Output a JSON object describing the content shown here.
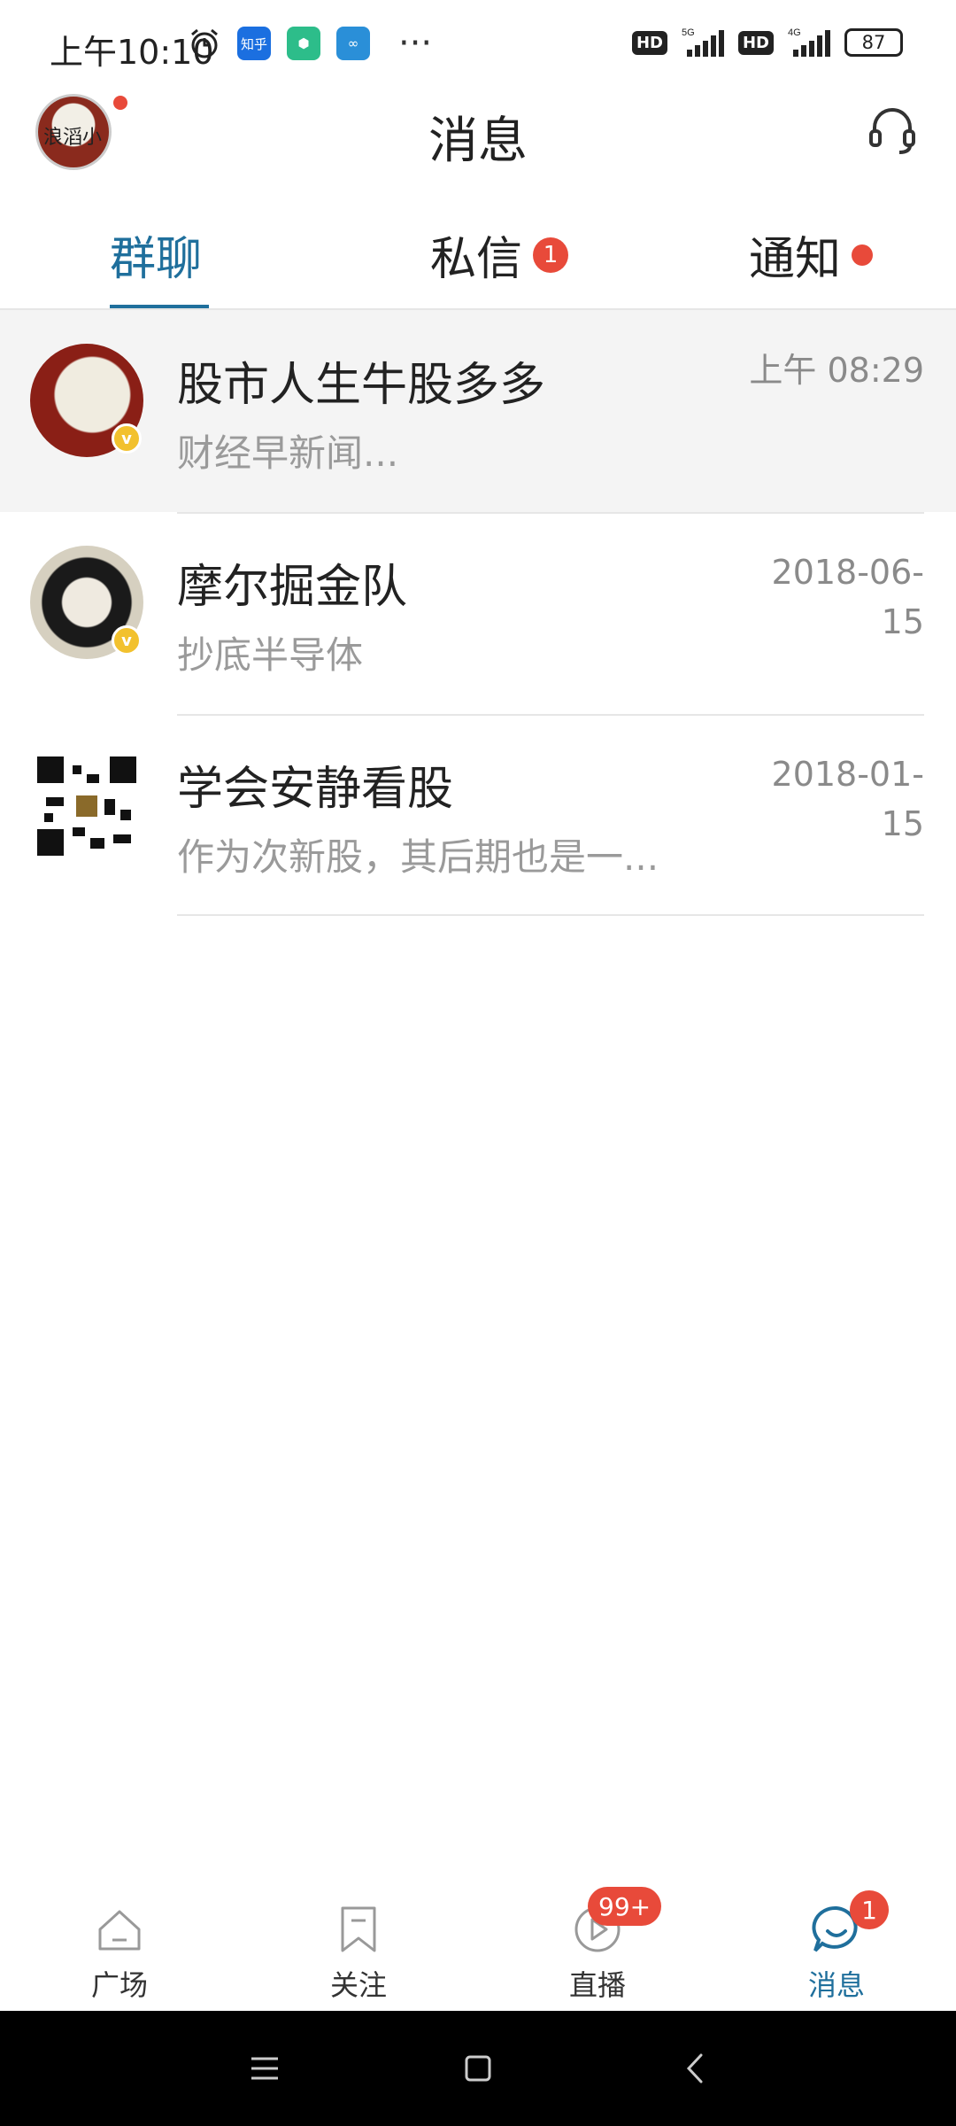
{
  "status_bar": {
    "time": "上午10:10",
    "apps": [
      "知乎"
    ],
    "battery": "87"
  },
  "header": {
    "title": "消息"
  },
  "tabs": [
    {
      "label": "群聊",
      "active": true
    },
    {
      "label": "私信",
      "badge": "1"
    },
    {
      "label": "通知",
      "dot": true
    }
  ],
  "conversations": [
    {
      "name": "股市人生牛股多多",
      "preview": "财经早新闻...",
      "time": "上午 08:29",
      "verified": true,
      "highlighted": true
    },
    {
      "name": "摩尔掘金队",
      "preview": "抄底半导体",
      "time": "2018-06-15",
      "verified": true
    },
    {
      "name": "学会安静看股",
      "preview": "作为次新股，其后期也是一...",
      "time": "2018-01-15"
    }
  ],
  "bottom_nav": [
    {
      "label": "广场",
      "icon": "home-icon"
    },
    {
      "label": "关注",
      "icon": "bookmark-icon"
    },
    {
      "label": "直播",
      "icon": "play-icon",
      "badge": "99+"
    },
    {
      "label": "消息",
      "icon": "chat-bubble-icon",
      "badge": "1",
      "active": true
    }
  ],
  "colors": {
    "accent": "#1f6f9c",
    "badge": "#e84a3a",
    "verified": "#f2c12e"
  }
}
